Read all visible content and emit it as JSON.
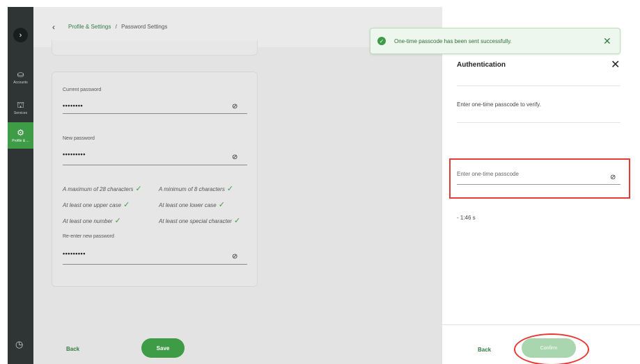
{
  "sidebar": {
    "expand_icon": "chevron-right-icon",
    "expand_glyph": "›",
    "items": [
      {
        "label": "Accounts",
        "icon": "accounts-icon",
        "glyph": "⛀",
        "active": false
      },
      {
        "label": "Services",
        "icon": "services-icon",
        "glyph": "⛫",
        "active": false
      },
      {
        "label": "Profile & ...",
        "icon": "gear-icon",
        "glyph": "⚙",
        "active": true
      }
    ],
    "history_icon": "history-icon",
    "history_glyph": "◷"
  },
  "breadcrumb": {
    "back_glyph": "‹",
    "parent": "Profile & Settings",
    "separator": "/",
    "current": "Password Settings"
  },
  "form": {
    "current_password": {
      "label": "Current password",
      "value": "••••••••"
    },
    "new_password": {
      "label": "New password",
      "value": "•••••••••"
    },
    "reenter_password": {
      "label": "Re-enter new password",
      "value": "•••••••••"
    },
    "eye_glyph": "⊘",
    "check_glyph": "✓",
    "rules": [
      "A maximum of 28 characters",
      "A minimum of 8 characters",
      "At least one upper case",
      "At least one lower case",
      "At least one number",
      "At least one special character"
    ]
  },
  "footer": {
    "back_label": "Back",
    "save_label": "Save"
  },
  "toast": {
    "message": "One-time passcode has been sent successfully.",
    "check_glyph": "✓",
    "close_glyph": "✕"
  },
  "auth_panel": {
    "title": "Authentication",
    "close_glyph": "✕",
    "instruction": "Enter one-time passcode to verify.",
    "otp_placeholder": "Enter one-time passcode",
    "eye_glyph": "⊘",
    "timer": "- 1:46 s",
    "back_label": "Back",
    "confirm_label": "Confirm"
  },
  "colors": {
    "sidebar_bg": "#2f3435",
    "accent_green": "#3e9b46",
    "confirm_disabled": "#a9d6ae",
    "annotation_red": "#e53935"
  }
}
